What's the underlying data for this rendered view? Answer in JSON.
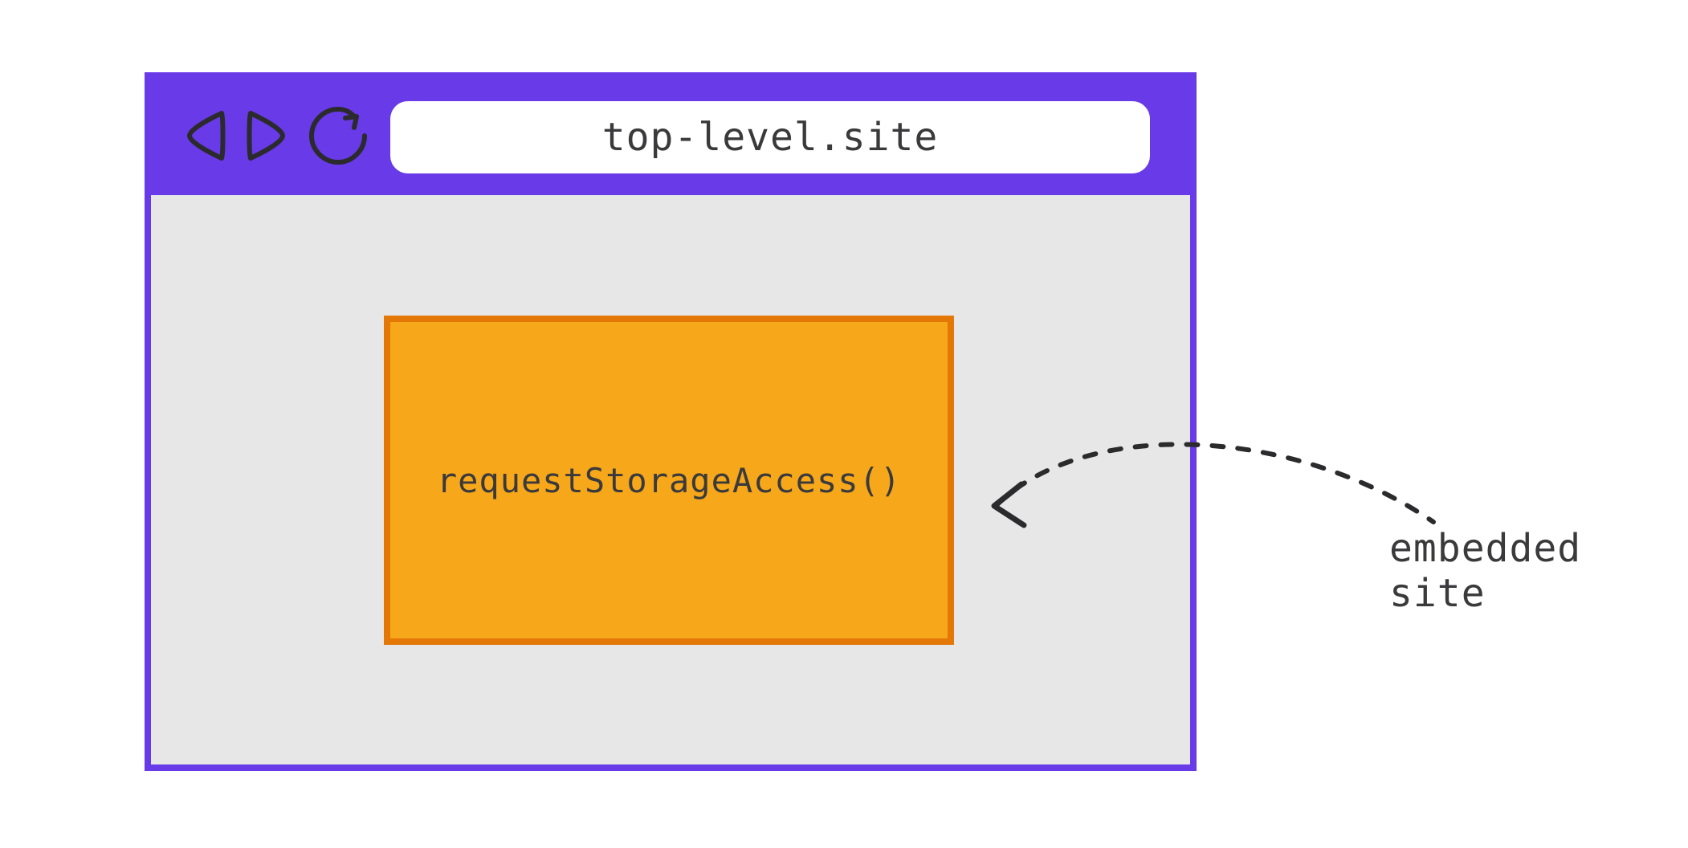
{
  "browser": {
    "url": "top-level.site",
    "nav": {
      "back_icon": "back",
      "forward_icon": "forward",
      "reload_icon": "reload"
    }
  },
  "embedded": {
    "code": "requestStorageAccess()"
  },
  "annotation": {
    "label": "embedded site"
  },
  "colors": {
    "browser_chrome": "#683AE8",
    "browser_content_bg": "#E8E7E7",
    "embed_fill": "#F7A71A",
    "embed_border": "#E37807",
    "text": "#3A3A3C",
    "stroke": "#2B2B2D"
  }
}
